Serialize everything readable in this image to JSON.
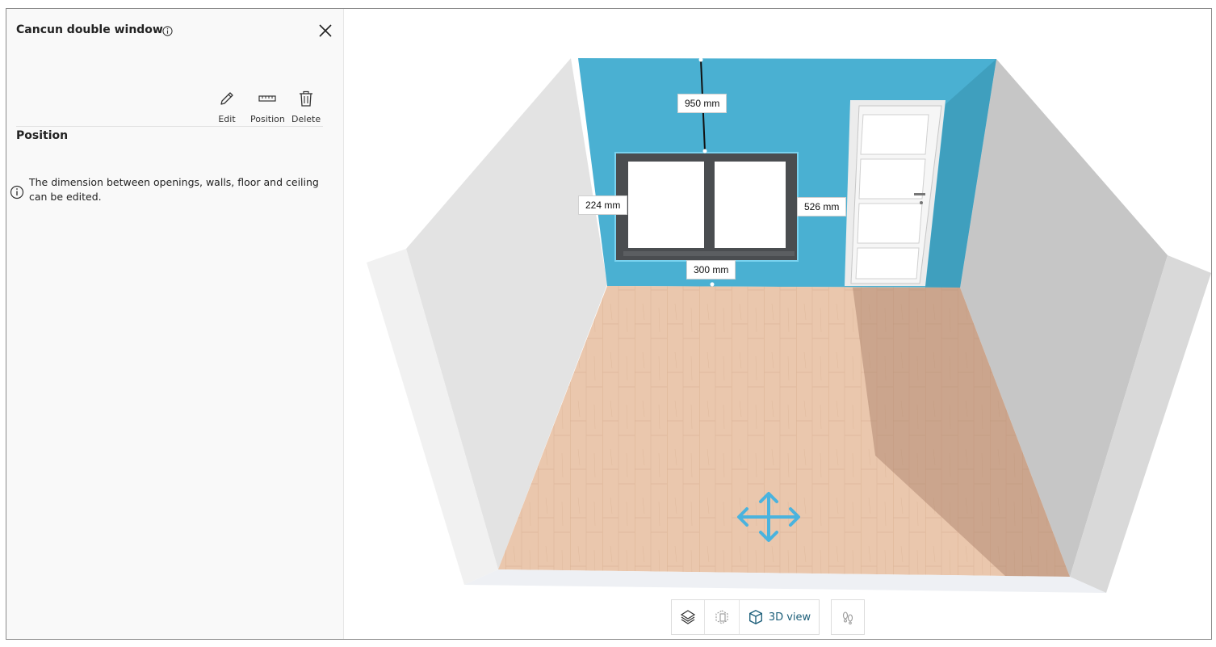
{
  "panel": {
    "title": "Cancun double window",
    "actions": [
      {
        "label": "Edit",
        "icon": "pencil-icon"
      },
      {
        "label": "Position",
        "icon": "ruler-icon"
      },
      {
        "label": "Delete",
        "icon": "trash-icon"
      }
    ],
    "section_heading": "Position",
    "notice": "The dimension between openings, walls, floor and ceiling can be edited."
  },
  "dimensions": {
    "top": "950 mm",
    "left": "224 mm",
    "right": "526 mm",
    "bottom": "300 mm"
  },
  "view_toolbar": {
    "view3d_label": "3D view"
  },
  "colors": {
    "accent_wall": "#4ab0d2",
    "floor": "#e8c3a8",
    "move_arrows": "#4ab3de"
  }
}
